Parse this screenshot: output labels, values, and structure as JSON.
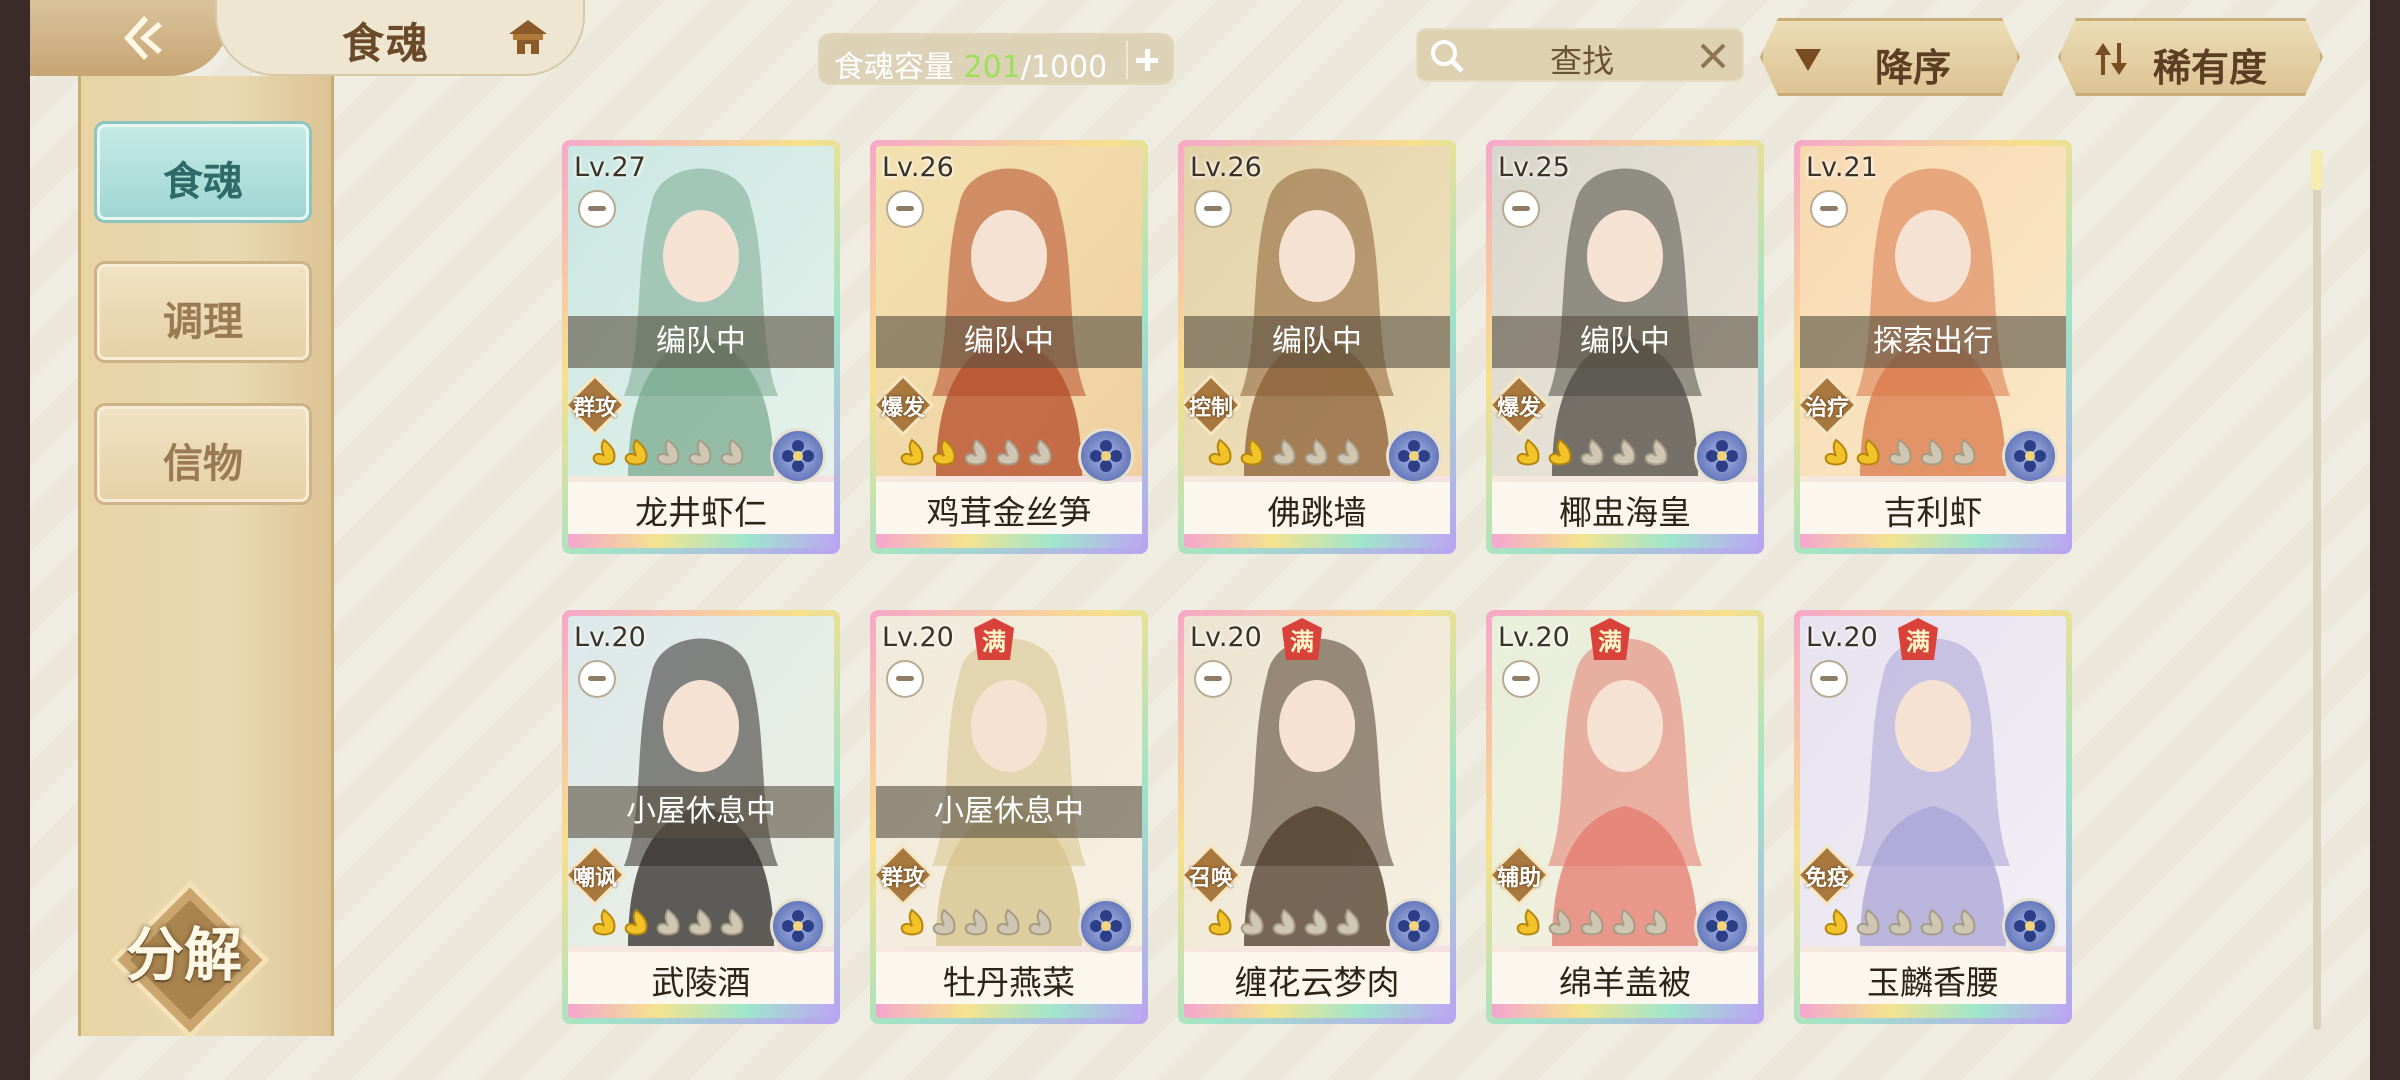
{
  "header": {
    "title": "食魂",
    "capacity": {
      "label": "食魂容量 ",
      "current": "201",
      "max": "/1000"
    },
    "search_placeholder": "查找",
    "sort_order": "降序",
    "sort_key": "稀有度"
  },
  "sidebar": {
    "tabs": [
      {
        "label": "食魂",
        "active": true
      },
      {
        "label": "调理",
        "active": false
      },
      {
        "label": "信物",
        "active": false
      }
    ],
    "decompose_label": "分解"
  },
  "colors": {
    "accent": "#9fd6d2",
    "panel": "#e9d9b2",
    "capacity_current": "#9be05a"
  },
  "cards": [
    {
      "level": "Lv.27",
      "name": "龙井虾仁",
      "status": "编队中",
      "role": "群攻",
      "stars": 2,
      "full": false,
      "full_label": ""
    },
    {
      "level": "Lv.26",
      "name": "鸡茸金丝笋",
      "status": "编队中",
      "role": "爆发",
      "stars": 2,
      "full": false,
      "full_label": ""
    },
    {
      "level": "Lv.26",
      "name": "佛跳墙",
      "status": "编队中",
      "role": "控制",
      "stars": 2,
      "full": false,
      "full_label": ""
    },
    {
      "level": "Lv.25",
      "name": "椰盅海皇",
      "status": "编队中",
      "role": "爆发",
      "stars": 2,
      "full": false,
      "full_label": ""
    },
    {
      "level": "Lv.21",
      "name": "吉利虾",
      "status": "探索出行",
      "role": "治疗",
      "stars": 2,
      "full": false,
      "full_label": ""
    },
    {
      "level": "Lv.20",
      "name": "武陵酒",
      "status": "小屋休息中",
      "role": "嘲讽",
      "stars": 2,
      "full": false,
      "full_label": ""
    },
    {
      "level": "Lv.20",
      "name": "牡丹燕菜",
      "status": "小屋休息中",
      "role": "群攻",
      "stars": 1,
      "full": true,
      "full_label": "满"
    },
    {
      "level": "Lv.20",
      "name": "缠花云梦肉",
      "status": "",
      "role": "召唤",
      "stars": 1,
      "full": true,
      "full_label": "满"
    },
    {
      "level": "Lv.20",
      "name": "绵羊盖被",
      "status": "",
      "role": "辅助",
      "stars": 1,
      "full": true,
      "full_label": "满"
    },
    {
      "level": "Lv.20",
      "name": "玉麟香腰",
      "status": "",
      "role": "免疫",
      "stars": 1,
      "full": true,
      "full_label": "满"
    }
  ]
}
